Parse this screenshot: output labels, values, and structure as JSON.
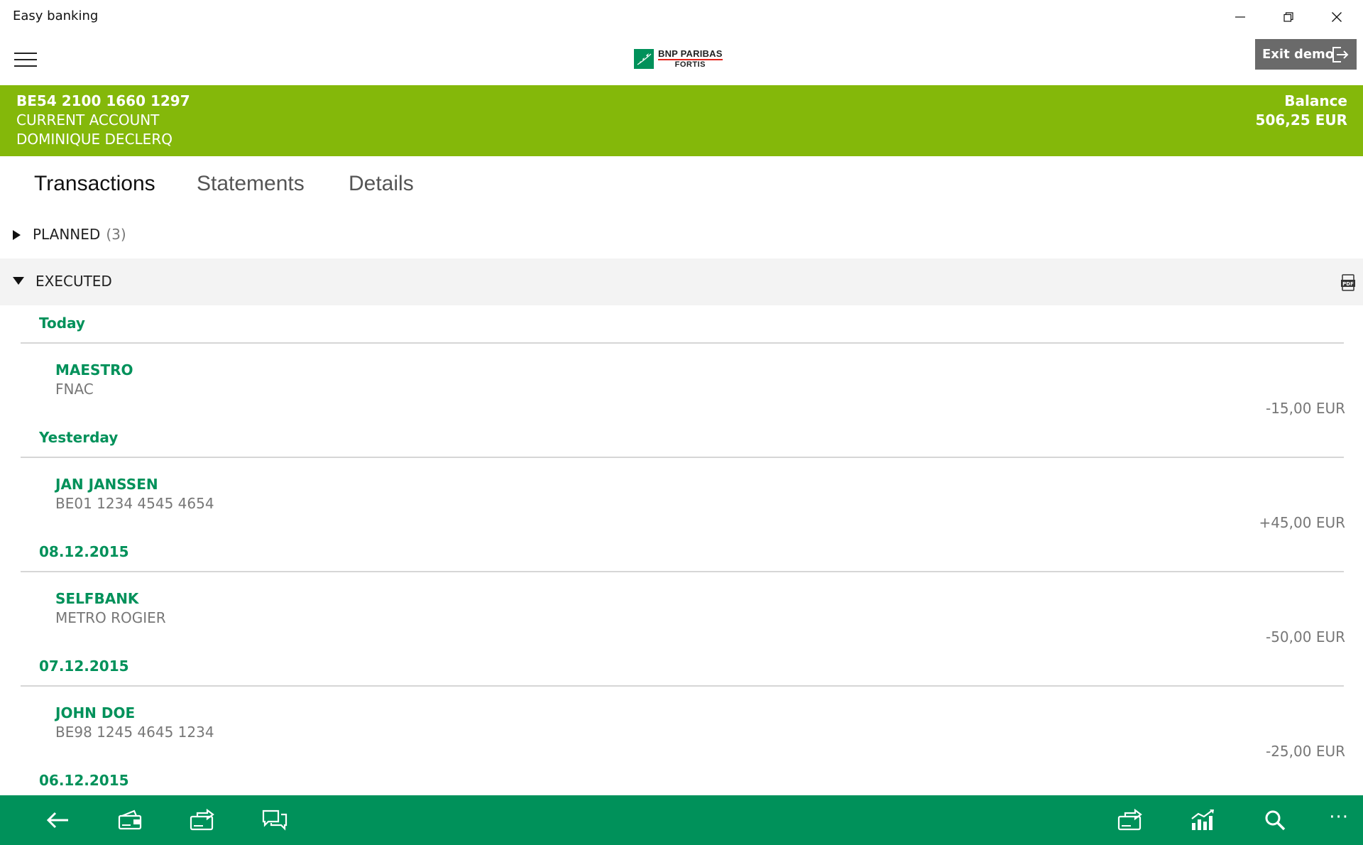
{
  "window": {
    "title": "Easy banking"
  },
  "header": {
    "logo_line1": "BNP PARIBAS",
    "logo_line2": "FORTIS",
    "exit_label": "Exit demo"
  },
  "account": {
    "iban": "BE54 2100 1660 1297",
    "type": "CURRENT ACCOUNT",
    "holder": "DOMINIQUE DECLERQ",
    "balance_label": "Balance",
    "balance_value": "506,25 EUR"
  },
  "tabs": [
    {
      "label": "Transactions",
      "active": true
    },
    {
      "label": "Statements",
      "active": false
    },
    {
      "label": "Details",
      "active": false
    }
  ],
  "sections": {
    "planned_label": "PLANNED",
    "planned_count": "(3)",
    "executed_label": "EXECUTED"
  },
  "groups": [
    {
      "date": "Today",
      "name": "MAESTRO",
      "desc": "FNAC",
      "amount": "-15,00 EUR"
    },
    {
      "date": "Yesterday",
      "name": "JAN JANSSEN",
      "desc": "BE01 1234 4545 4654",
      "amount": "+45,00 EUR"
    },
    {
      "date": "08.12.2015",
      "name": "SELFBANK",
      "desc": "METRO ROGIER",
      "amount": "-50,00 EUR"
    },
    {
      "date": "07.12.2015",
      "name": "JOHN DOE",
      "desc": "BE98 1245 4645 1234",
      "amount": "-25,00 EUR"
    },
    {
      "date": "06.12.2015"
    }
  ],
  "bottom_bar": {
    "more": "···"
  },
  "colors": {
    "brand_green": "#00915a",
    "account_green": "#84b80a",
    "exit_gray": "#6a6a6a"
  }
}
